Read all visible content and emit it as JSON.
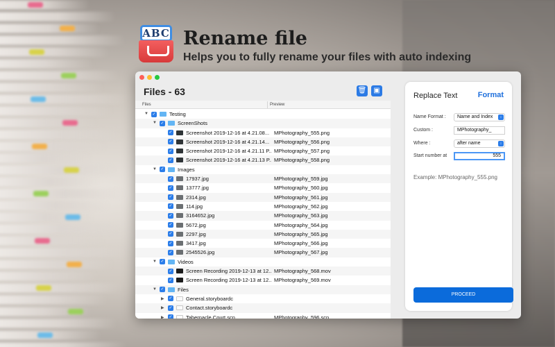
{
  "header": {
    "icon_text": "ABC",
    "title": "Rename file",
    "subtitle": "Helps you to fully rename your files with auto indexing"
  },
  "window": {
    "files_title": "Files - 63",
    "columns": {
      "files": "Files",
      "preview": "Preview"
    },
    "rows": [
      {
        "level": 0,
        "type": "folder",
        "name": "Testing",
        "preview": "",
        "expanded": true
      },
      {
        "level": 1,
        "type": "folder",
        "name": "ScreenShots",
        "preview": "",
        "expanded": true
      },
      {
        "level": 2,
        "type": "shot",
        "name": "Screenshot 2019-12-16 at 4.21.08...",
        "preview": "MPhotography_555.png"
      },
      {
        "level": 2,
        "type": "shot",
        "name": "Screenshot 2019-12-16 at 4.21.14...",
        "preview": "MPhotography_556.png"
      },
      {
        "level": 2,
        "type": "shot",
        "name": "Screenshot 2019-12-16 at 4.21.11 P...",
        "preview": "MPhotography_557.png"
      },
      {
        "level": 2,
        "type": "shot",
        "name": "Screenshot 2019-12-16 at 4.21.13 P...",
        "preview": "MPhotography_558.png"
      },
      {
        "level": 1,
        "type": "folder",
        "name": "Images",
        "preview": "",
        "expanded": true
      },
      {
        "level": 2,
        "type": "img",
        "name": "17937.jpg",
        "preview": "MPhotography_559.jpg"
      },
      {
        "level": 2,
        "type": "img",
        "name": "13777.jpg",
        "preview": "MPhotography_560.jpg"
      },
      {
        "level": 2,
        "type": "img",
        "name": "2314.jpg",
        "preview": "MPhotography_561.jpg"
      },
      {
        "level": 2,
        "type": "img",
        "name": "114.jpg",
        "preview": "MPhotography_562.jpg"
      },
      {
        "level": 2,
        "type": "img",
        "name": "3164652.jpg",
        "preview": "MPhotography_563.jpg"
      },
      {
        "level": 2,
        "type": "img",
        "name": "5672.jpg",
        "preview": "MPhotography_564.jpg"
      },
      {
        "level": 2,
        "type": "img",
        "name": "2297.jpg",
        "preview": "MPhotography_565.jpg"
      },
      {
        "level": 2,
        "type": "img",
        "name": "3417.jpg",
        "preview": "MPhotography_566.jpg"
      },
      {
        "level": 2,
        "type": "img",
        "name": "2545526.jpg",
        "preview": "MPhotography_567.jpg"
      },
      {
        "level": 1,
        "type": "folder",
        "name": "Videos",
        "preview": "",
        "expanded": true
      },
      {
        "level": 2,
        "type": "vid",
        "name": "Screen Recording 2019-12-13 at 12...",
        "preview": "MPhotography_568.mov"
      },
      {
        "level": 2,
        "type": "vid",
        "name": "Screen Recording 2019-12-13 at 12...",
        "preview": "MPhotography_569.mov"
      },
      {
        "level": 1,
        "type": "folder",
        "name": "Files",
        "preview": "",
        "expanded": true
      },
      {
        "level": 2,
        "type": "doc",
        "name": "General.storyboardc",
        "preview": "",
        "expandable": true
      },
      {
        "level": 2,
        "type": "doc",
        "name": "Contact.storyboardc",
        "preview": "",
        "expandable": true
      },
      {
        "level": 2,
        "type": "doc",
        "name": "Tabernacle Court.scn",
        "preview": "MPhotography_596.scn",
        "expandable": true
      }
    ]
  },
  "panel": {
    "title": "Replace Text",
    "format_label": "Format",
    "name_format_label": "Name Format :",
    "name_format_value": "Name and Index",
    "custom_label": "Custom :",
    "custom_value": "MPhotography_",
    "where_label": "Where :",
    "where_value": "after name",
    "start_label": "Start number at",
    "start_value": "555",
    "example": "Example: MPhotography_555.png",
    "proceed_label": "PROCEED"
  },
  "colors": {
    "accent": "#0b6bdb",
    "checkbox": "#2b7de9",
    "folder": "#63b5f4"
  }
}
